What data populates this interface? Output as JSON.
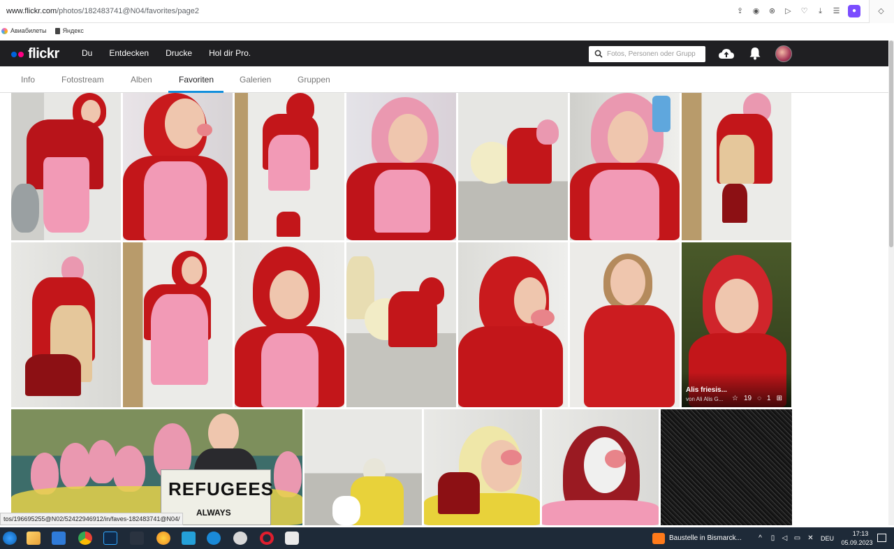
{
  "browser": {
    "url_host": "www.flickr.com",
    "url_path": "/photos/182483741@N04/favorites/page2",
    "bookmarks": [
      {
        "label": "Авиабилеты",
        "icon": "airplane-icon"
      },
      {
        "label": "Яндекс",
        "icon": "document-icon"
      }
    ],
    "status_url": "tos/196695255@N02/52422946912/in/faves-182483741@N04/"
  },
  "flickr": {
    "logo": "flickr",
    "main_nav": [
      "Du",
      "Entdecken",
      "Drucke",
      "Hol dir Pro."
    ],
    "search_placeholder": "Fotos, Personen oder Grupp",
    "sub_nav": [
      "Info",
      "Fotostream",
      "Alben",
      "Favoriten",
      "Galerien",
      "Gruppen"
    ],
    "active_tab": "Favoriten",
    "colors": {
      "header": "#1f1f22",
      "accent": "#128fdc",
      "dot_blue": "#0063dc",
      "dot_pink": "#ff0084"
    }
  },
  "photos": {
    "hover_photo": {
      "title": "Alis friesis...",
      "by": "von Ali Alis G...",
      "faves": "19",
      "comments": "1"
    },
    "sign_text_1": "REFUGEES",
    "sign_text_2": "ALWAYS"
  },
  "taskbar": {
    "notification_text": "Baustelle in Bismarck...",
    "language": "DEU",
    "time": "17:13",
    "date": "05.09.2023"
  }
}
